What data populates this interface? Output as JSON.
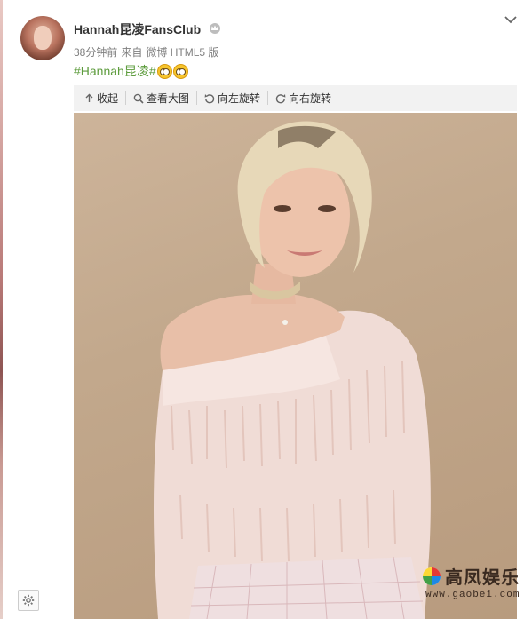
{
  "post": {
    "author": "Hannah昆凌FansClub",
    "time": "38分钟前",
    "source_prefix": "来自",
    "source": "微博 HTML5 版",
    "hashtag": "#Hannah昆凌#"
  },
  "toolbar": {
    "collapse": "收起",
    "view_large": "查看大图",
    "rotate_left": "向左旋转",
    "rotate_right": "向右旋转"
  },
  "watermark": {
    "title": "高凤娱乐",
    "url": "www.gaobei.com"
  },
  "colors": {
    "link_green": "#5d9c3d",
    "toolbar_bg": "#f2f2f2"
  }
}
